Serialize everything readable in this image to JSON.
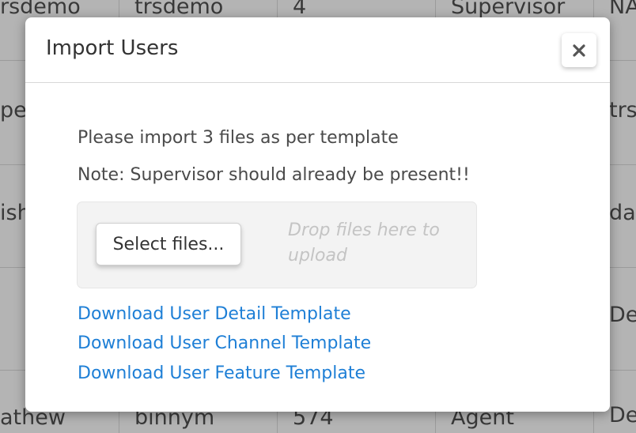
{
  "background_table": {
    "rows": [
      {
        "cells": [
          "rsdemo",
          "trsdemo",
          "4",
          "Supervisor",
          "NA"
        ]
      },
      {
        "cells": [
          "pe",
          "",
          "",
          "",
          "trs"
        ]
      },
      {
        "cells": [
          "ish",
          "",
          "",
          "",
          "da"
        ]
      },
      {
        "cells": [
          "",
          "",
          "",
          "",
          "De"
        ]
      },
      {
        "cells": [
          "",
          "",
          "",
          "",
          "De"
        ]
      },
      {
        "cells": [
          "athew",
          "binnym",
          "574",
          "Agent",
          "De"
        ]
      }
    ]
  },
  "modal": {
    "title": "Import Users",
    "close_icon": "close-icon",
    "instruction": "Please import 3 files as per template",
    "note": "Note: Supervisor should already be present!!",
    "upload": {
      "select_label": "Select files...",
      "drop_hint": "Drop files here to upload"
    },
    "links": [
      {
        "label": "Download User Detail Template"
      },
      {
        "label": "Download User Channel Template"
      },
      {
        "label": "Download User Feature Template"
      }
    ]
  },
  "colors": {
    "link": "#1e7fd6",
    "title": "#333333",
    "body_text": "#4a4a4a",
    "drop_hint": "#c4c4c4",
    "backdrop": "#c4c4c4"
  }
}
